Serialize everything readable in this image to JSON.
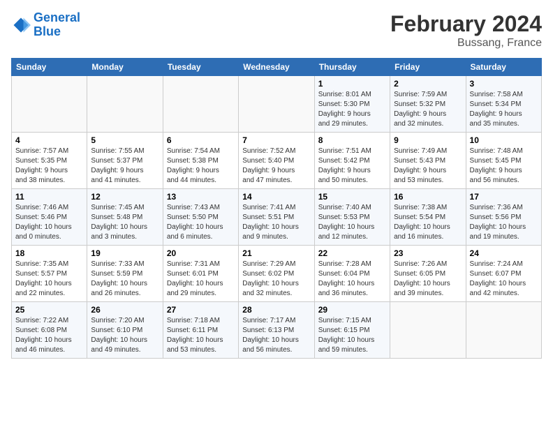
{
  "header": {
    "logo_line1": "General",
    "logo_line2": "Blue",
    "title": "February 2024",
    "subtitle": "Bussang, France"
  },
  "columns": [
    "Sunday",
    "Monday",
    "Tuesday",
    "Wednesday",
    "Thursday",
    "Friday",
    "Saturday"
  ],
  "weeks": [
    [
      {
        "day": "",
        "info": ""
      },
      {
        "day": "",
        "info": ""
      },
      {
        "day": "",
        "info": ""
      },
      {
        "day": "",
        "info": ""
      },
      {
        "day": "1",
        "info": "Sunrise: 8:01 AM\nSunset: 5:30 PM\nDaylight: 9 hours\nand 29 minutes."
      },
      {
        "day": "2",
        "info": "Sunrise: 7:59 AM\nSunset: 5:32 PM\nDaylight: 9 hours\nand 32 minutes."
      },
      {
        "day": "3",
        "info": "Sunrise: 7:58 AM\nSunset: 5:34 PM\nDaylight: 9 hours\nand 35 minutes."
      }
    ],
    [
      {
        "day": "4",
        "info": "Sunrise: 7:57 AM\nSunset: 5:35 PM\nDaylight: 9 hours\nand 38 minutes."
      },
      {
        "day": "5",
        "info": "Sunrise: 7:55 AM\nSunset: 5:37 PM\nDaylight: 9 hours\nand 41 minutes."
      },
      {
        "day": "6",
        "info": "Sunrise: 7:54 AM\nSunset: 5:38 PM\nDaylight: 9 hours\nand 44 minutes."
      },
      {
        "day": "7",
        "info": "Sunrise: 7:52 AM\nSunset: 5:40 PM\nDaylight: 9 hours\nand 47 minutes."
      },
      {
        "day": "8",
        "info": "Sunrise: 7:51 AM\nSunset: 5:42 PM\nDaylight: 9 hours\nand 50 minutes."
      },
      {
        "day": "9",
        "info": "Sunrise: 7:49 AM\nSunset: 5:43 PM\nDaylight: 9 hours\nand 53 minutes."
      },
      {
        "day": "10",
        "info": "Sunrise: 7:48 AM\nSunset: 5:45 PM\nDaylight: 9 hours\nand 56 minutes."
      }
    ],
    [
      {
        "day": "11",
        "info": "Sunrise: 7:46 AM\nSunset: 5:46 PM\nDaylight: 10 hours\nand 0 minutes."
      },
      {
        "day": "12",
        "info": "Sunrise: 7:45 AM\nSunset: 5:48 PM\nDaylight: 10 hours\nand 3 minutes."
      },
      {
        "day": "13",
        "info": "Sunrise: 7:43 AM\nSunset: 5:50 PM\nDaylight: 10 hours\nand 6 minutes."
      },
      {
        "day": "14",
        "info": "Sunrise: 7:41 AM\nSunset: 5:51 PM\nDaylight: 10 hours\nand 9 minutes."
      },
      {
        "day": "15",
        "info": "Sunrise: 7:40 AM\nSunset: 5:53 PM\nDaylight: 10 hours\nand 12 minutes."
      },
      {
        "day": "16",
        "info": "Sunrise: 7:38 AM\nSunset: 5:54 PM\nDaylight: 10 hours\nand 16 minutes."
      },
      {
        "day": "17",
        "info": "Sunrise: 7:36 AM\nSunset: 5:56 PM\nDaylight: 10 hours\nand 19 minutes."
      }
    ],
    [
      {
        "day": "18",
        "info": "Sunrise: 7:35 AM\nSunset: 5:57 PM\nDaylight: 10 hours\nand 22 minutes."
      },
      {
        "day": "19",
        "info": "Sunrise: 7:33 AM\nSunset: 5:59 PM\nDaylight: 10 hours\nand 26 minutes."
      },
      {
        "day": "20",
        "info": "Sunrise: 7:31 AM\nSunset: 6:01 PM\nDaylight: 10 hours\nand 29 minutes."
      },
      {
        "day": "21",
        "info": "Sunrise: 7:29 AM\nSunset: 6:02 PM\nDaylight: 10 hours\nand 32 minutes."
      },
      {
        "day": "22",
        "info": "Sunrise: 7:28 AM\nSunset: 6:04 PM\nDaylight: 10 hours\nand 36 minutes."
      },
      {
        "day": "23",
        "info": "Sunrise: 7:26 AM\nSunset: 6:05 PM\nDaylight: 10 hours\nand 39 minutes."
      },
      {
        "day": "24",
        "info": "Sunrise: 7:24 AM\nSunset: 6:07 PM\nDaylight: 10 hours\nand 42 minutes."
      }
    ],
    [
      {
        "day": "25",
        "info": "Sunrise: 7:22 AM\nSunset: 6:08 PM\nDaylight: 10 hours\nand 46 minutes."
      },
      {
        "day": "26",
        "info": "Sunrise: 7:20 AM\nSunset: 6:10 PM\nDaylight: 10 hours\nand 49 minutes."
      },
      {
        "day": "27",
        "info": "Sunrise: 7:18 AM\nSunset: 6:11 PM\nDaylight: 10 hours\nand 53 minutes."
      },
      {
        "day": "28",
        "info": "Sunrise: 7:17 AM\nSunset: 6:13 PM\nDaylight: 10 hours\nand 56 minutes."
      },
      {
        "day": "29",
        "info": "Sunrise: 7:15 AM\nSunset: 6:15 PM\nDaylight: 10 hours\nand 59 minutes."
      },
      {
        "day": "",
        "info": ""
      },
      {
        "day": "",
        "info": ""
      }
    ]
  ]
}
